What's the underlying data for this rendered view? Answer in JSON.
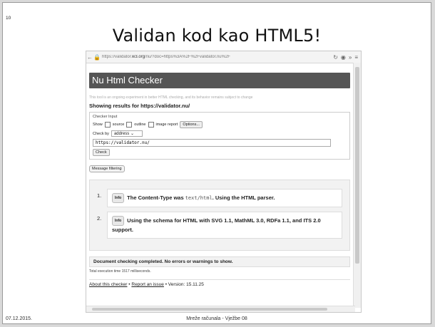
{
  "slide": {
    "title": "Validan kod kao HTML5!",
    "footer_date": "07.12.2015.",
    "footer_center": "Mreže računala - Vježbe 08",
    "footer_page": "10"
  },
  "browser": {
    "url_prefix": "https://validator.",
    "url_domain": "w3.org",
    "url_rest": "/nu/?doc=https%3A%2F%2Fvalidator.nu%2F",
    "icons": {
      "back": "back-arrow-icon",
      "lock": "lock-icon",
      "reload": "reload-icon",
      "extension": "extension-icon",
      "more": "chevron-right-icon",
      "menu": "menu-icon"
    }
  },
  "checker": {
    "header_title": "Nu Html Checker",
    "disclaimer": "This tool is an ongoing experiment in better HTML checking, and its behavior remains subject to change",
    "showing_results": "Showing results for https://validator.nu/",
    "input_legend": "Checker Input",
    "show_label": "Show",
    "options": [
      {
        "label": "source",
        "checked": false
      },
      {
        "label": "outline",
        "checked": false
      },
      {
        "label": "image report",
        "checked": false
      }
    ],
    "options_button": "Options...",
    "check_by_label": "Check by",
    "check_by_value": "address",
    "url_value": "https://validator.nu/",
    "check_button": "Check",
    "message_filtering": "Message filtering"
  },
  "results": [
    {
      "num": "1.",
      "badge": "Info",
      "text_a": "The Content-Type was ",
      "code": "text/html",
      "text_b": ". Using the HTML parser."
    },
    {
      "num": "2.",
      "badge": "Info",
      "text_a": "Using the schema for HTML with SVG 1.1, MathML 3.0, RDFa 1.1, and ITS 2.0 support."
    }
  ],
  "summary": {
    "completed": "Document checking completed. No errors or warnings to show.",
    "exec_time": "Total execution time 1517 milliseconds."
  },
  "footer_links": {
    "about": "About this checker",
    "sep1": " • ",
    "report": "Report an issue",
    "sep2": " • ",
    "version": "Version: 15.11.25"
  }
}
